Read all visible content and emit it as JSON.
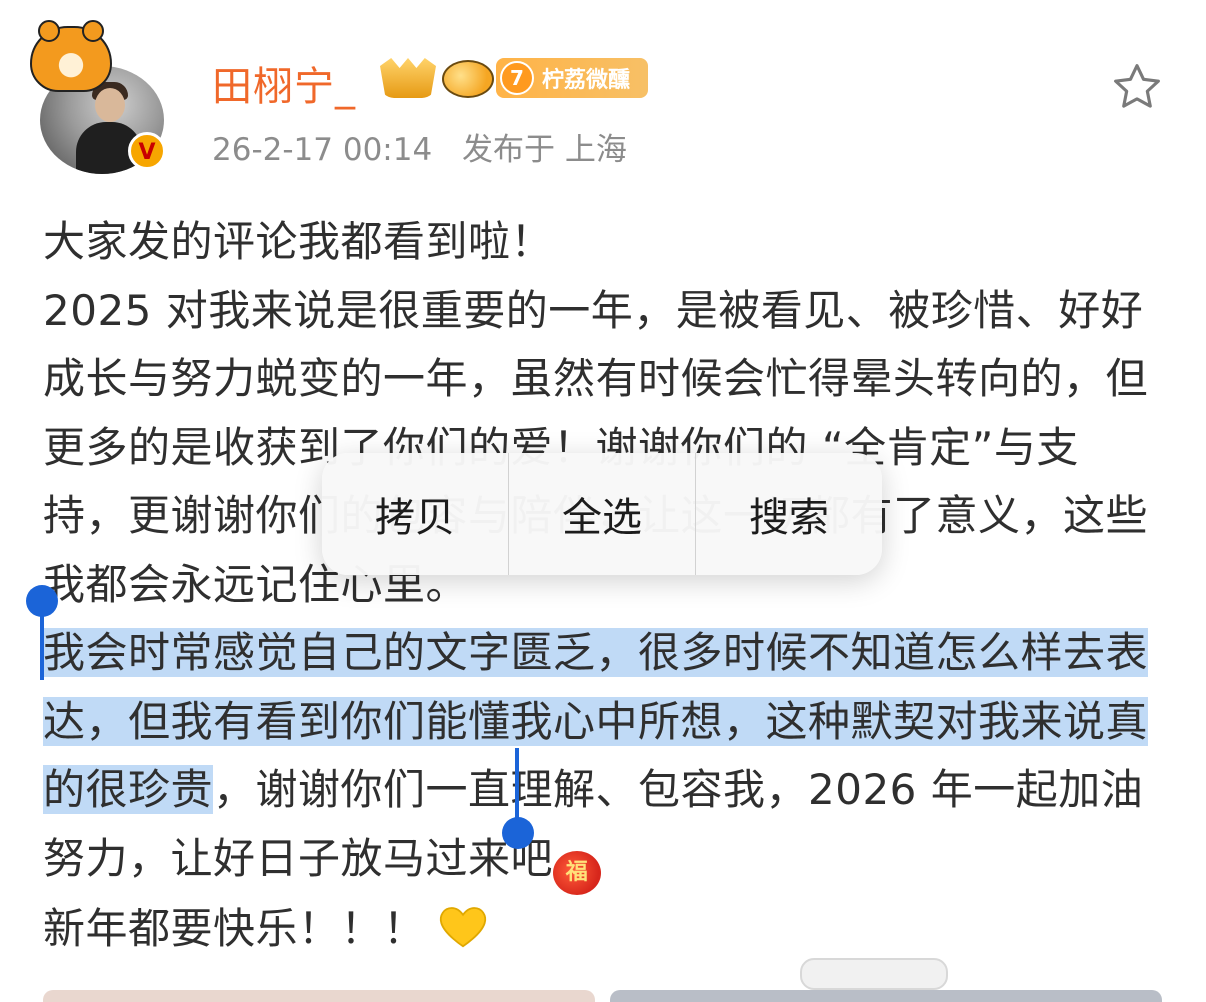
{
  "profile": {
    "username": "田栩宁_",
    "level": "7",
    "level_label": "柠荔微醺",
    "timestamp": "26-2-17 00:14",
    "location": "发布于 上海",
    "verified_mark": "V"
  },
  "post": {
    "line1": "大家发的评论我都看到啦！",
    "para2": "2025 对我来说是很重要的一年，是被看见、被珍惜、好好成长与努力蜕变的一年，虽然有时候会忙得晕头转向的，但更多的是收获到了你们的爱！谢谢你们的 “全肯定”与支持，更谢谢你们的包容与陪伴，让这一切都有了意义，这些我都会永远记住心里。",
    "para3_selected": "我会时常感觉自己的文字匮乏，很多时候不知道怎么样去表达，但我有看到你们能懂我心中所想，这种默契对我来说真的很珍贵",
    "para3_rest": "，谢谢你们一直理解、包容我，2026 年一起加油努力，让好日子放马过来吧",
    "fu_emoji": "福",
    "last_line": "新年都要快乐！！！"
  },
  "context_menu": {
    "copy": "拷贝",
    "select_all": "全选",
    "search": "搜索"
  },
  "colors": {
    "username": "#f0682a",
    "selection": "#c0daf6",
    "handle": "#1b64d8"
  }
}
